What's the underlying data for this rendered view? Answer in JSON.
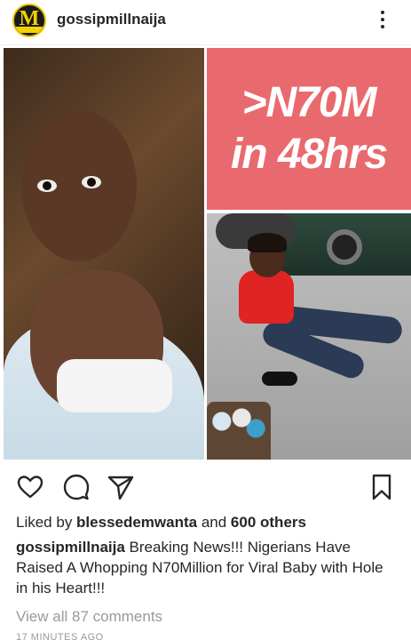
{
  "post": {
    "username": "gossipmillnaija",
    "avatar_letter": "M",
    "avatar_small": "OSSIPMI"
  },
  "media": {
    "headline_line1": ">N70M",
    "headline_line2": "in 48hrs",
    "headline_bg": "#e96a6e"
  },
  "actions": {
    "like_icon": "heart-icon",
    "comment_icon": "comment-icon",
    "share_icon": "send-icon",
    "save_icon": "bookmark-icon"
  },
  "likes": {
    "prefix": "Liked by ",
    "user": "blessedemwanta",
    "middle": " and ",
    "others": "600 others"
  },
  "caption": {
    "username": "gossipmillnaija",
    "text": " Breaking News!!! Nigerians Have Raised A Whopping N70Million for Viral Baby with Hole in his Heart!!!"
  },
  "comments": {
    "view_all": "View all 87 comments"
  },
  "time": {
    "label": "17 MINUTES AGO"
  }
}
